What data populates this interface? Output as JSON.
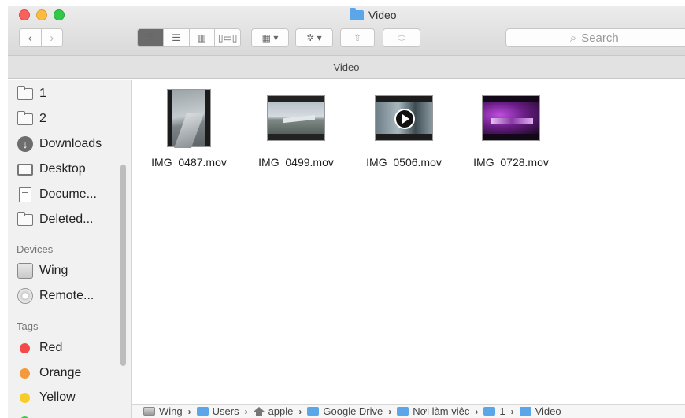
{
  "window": {
    "title": "Video"
  },
  "toolbar": {
    "back_glyph": "‹",
    "forward_glyph": "›",
    "view_modes": [
      "icon-view-icon",
      "list-view-icon",
      "column-view-icon",
      "coverflow-view-icon"
    ],
    "arrange_glyph": "▦ ▾",
    "action_glyph": "✲ ▾",
    "share_glyph": "⇧",
    "tag_glyph": "⬭"
  },
  "search": {
    "icon": "⌕",
    "placeholder": "Search"
  },
  "path_title": "Video",
  "sidebar": {
    "favorites": [
      {
        "label": "1",
        "icon": "folder-icon"
      },
      {
        "label": "2",
        "icon": "folder-icon"
      },
      {
        "label": "Downloads",
        "icon": "downloads-icon"
      },
      {
        "label": "Desktop",
        "icon": "desktop-icon"
      },
      {
        "label": "Docume...",
        "icon": "documents-icon"
      },
      {
        "label": "Deleted...",
        "icon": "folder-icon"
      }
    ],
    "devices_heading": "Devices",
    "devices": [
      {
        "label": "Wing",
        "icon": "hard-drive-icon"
      },
      {
        "label": "Remote...",
        "icon": "remote-disc-icon"
      }
    ],
    "tags_heading": "Tags",
    "tags": [
      {
        "label": "Red",
        "color": "#f44a4a"
      },
      {
        "label": "Orange",
        "color": "#f59a3a"
      },
      {
        "label": "Yellow",
        "color": "#f7cd2c"
      }
    ]
  },
  "files": [
    {
      "name": "IMG_0487.mov"
    },
    {
      "name": "IMG_0499.mov"
    },
    {
      "name": "IMG_0506.mov"
    },
    {
      "name": "IMG_0728.mov"
    }
  ],
  "pathbar": {
    "crumbs": [
      "Wing",
      "Users",
      "apple",
      "Google Drive",
      "Nơi làm việc",
      "1",
      "Video"
    ],
    "separator": "›"
  }
}
